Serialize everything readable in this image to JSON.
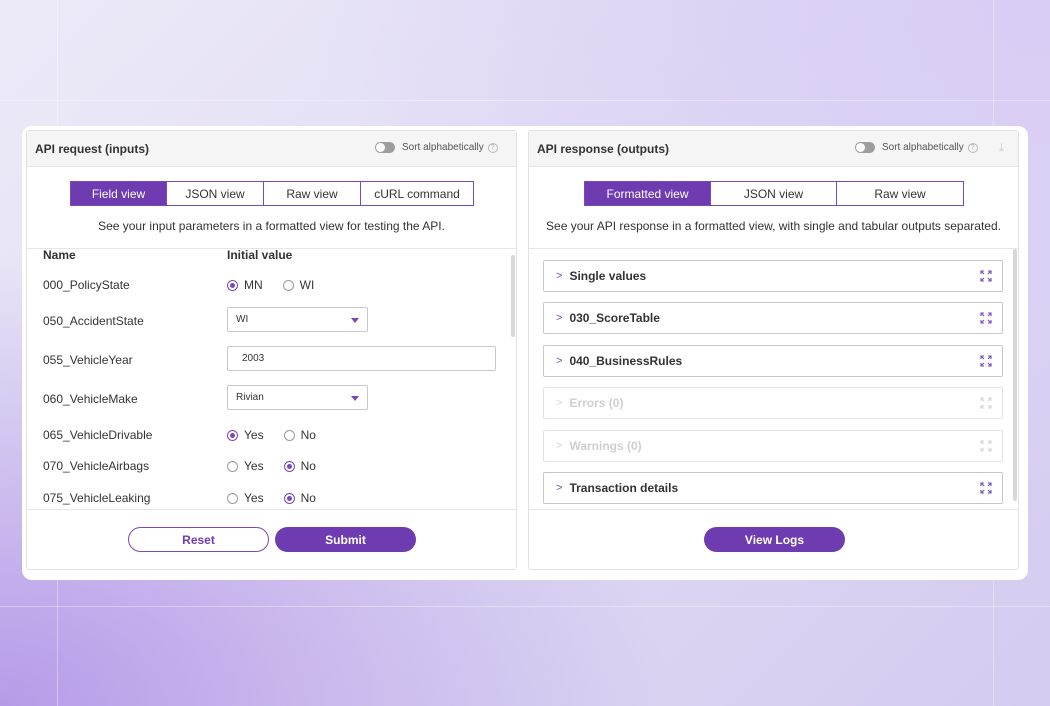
{
  "left_panel": {
    "title": "API request (inputs)",
    "sort_label": "Sort alphabetically",
    "tabs": [
      {
        "label": "Field view",
        "active": true
      },
      {
        "label": "JSON view",
        "active": false
      },
      {
        "label": "Raw view",
        "active": false
      },
      {
        "label": "cURL command",
        "active": false
      }
    ],
    "description": "See your input parameters in a formatted view for testing the API.",
    "columns": {
      "name": "Name",
      "value": "Initial value"
    },
    "fields": [
      {
        "label": "000_PolicyState",
        "type": "radio",
        "options": [
          "MN",
          "WI"
        ],
        "selected": "MN"
      },
      {
        "label": "050_AccidentState",
        "type": "select",
        "value": "WI"
      },
      {
        "label": "055_VehicleYear",
        "type": "text",
        "value": "2003"
      },
      {
        "label": "060_VehicleMake",
        "type": "select",
        "value": "Rivian"
      },
      {
        "label": "065_VehicleDrivable",
        "type": "radio",
        "options": [
          "Yes",
          "No"
        ],
        "selected": "Yes"
      },
      {
        "label": "070_VehicleAirbags",
        "type": "radio",
        "options": [
          "Yes",
          "No"
        ],
        "selected": "No"
      },
      {
        "label": "075_VehicleLeaking",
        "type": "radio",
        "options": [
          "Yes",
          "No"
        ],
        "selected": "No"
      }
    ],
    "reset_label": "Reset",
    "submit_label": "Submit"
  },
  "right_panel": {
    "title": "API response (outputs)",
    "sort_label": "Sort alphabetically",
    "tabs": [
      {
        "label": "Formatted view",
        "active": true
      },
      {
        "label": "JSON view",
        "active": false
      },
      {
        "label": "Raw view",
        "active": false
      }
    ],
    "description": "See your API response in a formatted view, with single and tabular outputs separated.",
    "sections": [
      {
        "label": "Single values",
        "enabled": true
      },
      {
        "label": "030_ScoreTable",
        "enabled": true
      },
      {
        "label": "040_BusinessRules",
        "enabled": true
      },
      {
        "label": "Errors (0)",
        "enabled": false
      },
      {
        "label": "Warnings (0)",
        "enabled": false
      },
      {
        "label": "Transaction details",
        "enabled": true
      }
    ],
    "view_logs_label": "View Logs"
  },
  "colors": {
    "accent": "#6e3bb0",
    "border_accent": "#7a48b8"
  },
  "icons": {
    "help": "question-circle-icon",
    "download": "download-icon",
    "chevron": "chevron-right-icon",
    "expand": "expand-icon",
    "caret": "caret-down-icon"
  }
}
